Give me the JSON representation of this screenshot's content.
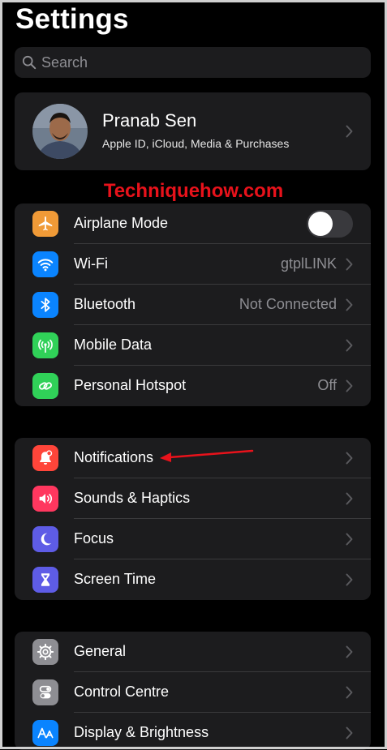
{
  "title": "Settings",
  "search": {
    "placeholder": "Search"
  },
  "profile": {
    "name": "Pranab Sen",
    "subtitle": "Apple ID, iCloud, Media & Purchases"
  },
  "watermark": "Techniquehow.com",
  "groups": [
    {
      "items": [
        {
          "label": "Airplane Mode",
          "icon": "airplane-icon",
          "color": "#f09a37",
          "toggle": false
        },
        {
          "label": "Wi-Fi",
          "value": "gtplLINK",
          "icon": "wifi-icon",
          "color": "#0a84ff"
        },
        {
          "label": "Bluetooth",
          "value": "Not Connected",
          "icon": "bluetooth-icon",
          "color": "#0a84ff"
        },
        {
          "label": "Mobile Data",
          "icon": "antenna-icon",
          "color": "#30d158"
        },
        {
          "label": "Personal Hotspot",
          "value": "Off",
          "icon": "hotspot-icon",
          "color": "#30d158"
        }
      ]
    },
    {
      "items": [
        {
          "label": "Notifications",
          "icon": "bell-icon",
          "color": "#ff453a"
        },
        {
          "label": "Sounds & Haptics",
          "icon": "speaker-icon",
          "color": "#ff375f"
        },
        {
          "label": "Focus",
          "icon": "moon-icon",
          "color": "#5e5ce6"
        },
        {
          "label": "Screen Time",
          "icon": "hourglass-icon",
          "color": "#5e5ce6"
        }
      ]
    },
    {
      "items": [
        {
          "label": "General",
          "icon": "gear-icon",
          "color": "#8e8e93"
        },
        {
          "label": "Control Centre",
          "icon": "switches-icon",
          "color": "#8e8e93"
        },
        {
          "label": "Display & Brightness",
          "icon": "text-size-icon",
          "color": "#0a84ff"
        }
      ]
    }
  ]
}
